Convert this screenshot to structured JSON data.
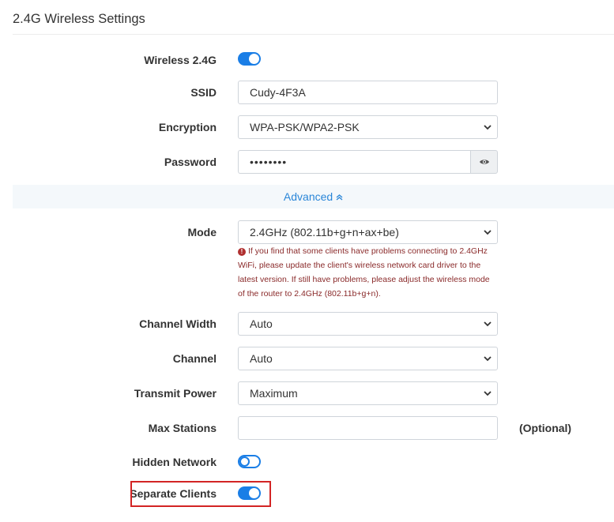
{
  "panel": {
    "title": "2.4G Wireless Settings"
  },
  "fields": {
    "wireless": {
      "label": "Wireless 2.4G",
      "state": "on"
    },
    "ssid": {
      "label": "SSID",
      "value": "Cudy-4F3A"
    },
    "encryption": {
      "label": "Encryption",
      "value": "WPA-PSK/WPA2-PSK"
    },
    "password": {
      "label": "Password",
      "value": "••••••••"
    },
    "advanced": {
      "label": "Advanced",
      "icon": "double-chevron-up-icon"
    },
    "mode": {
      "label": "Mode",
      "value": "2.4GHz (802.11b+g+n+ax+be)",
      "note": "If you find that some clients have problems connecting to 2.4GHz WiFi, please update the client's wireless network card driver to the latest version. If still have problems, please adjust the wireless mode of the router to 2.4GHz (802.11b+g+n)."
    },
    "channel_width": {
      "label": "Channel Width",
      "value": "Auto"
    },
    "channel": {
      "label": "Channel",
      "value": "Auto"
    },
    "transmit_power": {
      "label": "Transmit Power",
      "value": "Maximum"
    },
    "max_stations": {
      "label": "Max Stations",
      "value": "",
      "hint": "(Optional)"
    },
    "hidden_network": {
      "label": "Hidden Network",
      "state": "off"
    },
    "separate_clients": {
      "label": "Separate Clients",
      "state": "on"
    }
  },
  "colors": {
    "accent": "#1a7ee6",
    "highlight": "#d32424",
    "note": "#8a2a2a",
    "link": "#2a86d8"
  }
}
